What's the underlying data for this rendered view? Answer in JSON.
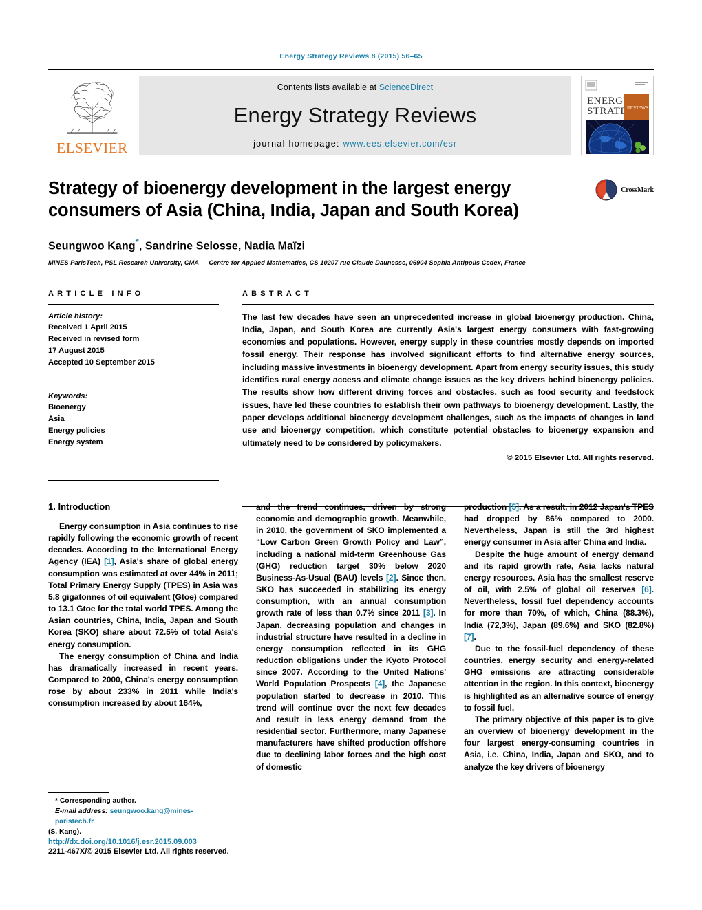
{
  "running_head": "Energy Strategy Reviews 8 (2015) 56–65",
  "masthead": {
    "publisher_name": "ELSEVIER",
    "contents_prefix": "Contents lists available at ",
    "contents_link": "ScienceDirect",
    "journal_name": "Energy Strategy Reviews",
    "homepage_prefix": "journal homepage: ",
    "homepage_url": "www.ees.elsevier.com/esr",
    "cover": {
      "line1": "ENERGY",
      "line2": "STRATEGY",
      "badge": "REVIEWS"
    }
  },
  "article": {
    "title": "Strategy of bioenergy development in the largest energy consumers of Asia (China, India, Japan and South Korea)",
    "authors": "Seungwoo Kang",
    "authors_rest": ", Sandrine Selosse, Nadia Maïzi",
    "corresponding_marker": "*",
    "affiliation": "MINES ParisTech, PSL Research University, CMA — Centre for Applied Mathematics, CS 10207 rue Claude Daunesse, 06904 Sophia Antipolis Cedex, France",
    "crossmark_label": "CrossMark"
  },
  "article_info": {
    "heading": "ARTICLE INFO",
    "history_label": "Article history:",
    "history_lines": [
      "Received 1 April 2015",
      "Received in revised form",
      "17 August 2015",
      "Accepted 10 September 2015"
    ],
    "keywords_label": "Keywords:",
    "keywords": [
      "Bioenergy",
      "Asia",
      "Energy policies",
      "Energy system"
    ]
  },
  "abstract": {
    "heading": "ABSTRACT",
    "text": "The last few decades have seen an unprecedented increase in global bioenergy production. China, India, Japan, and South Korea are currently Asia's largest energy consumers with fast-growing economies and populations. However, energy supply in these countries mostly depends on imported fossil energy. Their response has involved significant efforts to find alternative energy sources, including massive investments in bioenergy development. Apart from energy security issues, this study identifies rural energy access and climate change issues as the key drivers behind bioenergy policies. The results show how different driving forces and obstacles, such as food security and feedstock issues, have led these countries to establish their own pathways to bioenergy development. Lastly, the paper develops additional bioenergy development challenges, such as the impacts of changes in land use and bioenergy competition, which constitute potential obstacles to bioenergy expansion and ultimately need to be considered by policymakers.",
    "copyright": "© 2015 Elsevier Ltd. All rights reserved."
  },
  "body": {
    "section_number_title": "1. Introduction",
    "col1": {
      "p1_a": "Energy consumption in Asia continues to rise rapidly following the economic growth of recent decades. According to the International Energy Agency (IEA) ",
      "p1_ref": "[1]",
      "p1_b": ", Asia's share of global energy consumption was estimated at over 44% in 2011; Total Primary Energy Supply (TPES) in Asia was 5.8 gigatonnes of oil equivalent (Gtoe) compared to 13.1 Gtoe for the total world TPES. Among the Asian countries, China, India, Japan and South Korea (SKO) share about 72.5% of total Asia's energy consumption.",
      "p2": "The energy consumption of China and India has dramatically increased in recent years. Compared to 2000, China's energy consumption rose by about 233% in 2011 while India's consumption increased by about 164%,"
    },
    "col2": {
      "a": "and the trend continues, driven by strong economic and demographic growth. Meanwhile, in 2010, the government of SKO implemented a “Low Carbon Green Growth Policy and Law”, including a national mid-term Greenhouse Gas (GHG) reduction target 30% below 2020 Business-As-Usual (BAU) levels ",
      "ref1": "[2]",
      "b": ". Since then, SKO has succeeded in stabilizing its energy consumption, with an annual consumption growth rate of less than 0.7% since 2011 ",
      "ref2": "[3]",
      "c": ". In Japan, decreasing population and changes in industrial structure have resulted in a decline in energy consumption reflected in its GHG reduction obligations under the Kyoto Protocol since 2007. According to the United Nations' World Population Prospects ",
      "ref3": "[4]",
      "d": ", the Japanese population started to decrease in 2010. This trend will continue over the next few decades and result in less energy demand from the residential sector. Furthermore, many Japanese manufacturers have shifted production offshore due to declining labor forces and the high cost of domestic"
    },
    "col3": {
      "a": "production ",
      "ref1": "[5]",
      "b": ". As a result, in 2012 Japan's TPES had dropped by 86% compared to 2000. Nevertheless, Japan is still the 3rd highest energy consumer in Asia after China and India.",
      "p2_a": "Despite the huge amount of energy demand and its rapid growth rate, Asia lacks natural energy resources. Asia has the smallest reserve of oil, with 2.5% of global oil reserves ",
      "p2_ref1": "[6]",
      "p2_b": ". Nevertheless, fossil fuel dependency accounts for more than 70%, of which, China (88.3%), India (72,3%), Japan (89,6%) and SKO (82.8%) ",
      "p2_ref2": "[7]",
      "p2_c": ".",
      "p3": "Due to the fossil-fuel dependency of these countries, energy security and energy-related GHG emissions are attracting considerable attention in the region. In this context, bioenergy is highlighted as an alternative source of energy to fossil fuel.",
      "p4": "The primary objective of this paper is to give an overview of bioenergy development in the four largest energy-consuming countries in Asia, i.e. China, India, Japan and SKO, and to analyze the key drivers of bioenergy"
    }
  },
  "footnote": {
    "corresponding": "* Corresponding author.",
    "email_label": "E-mail address:",
    "email": "seungwoo.kang@mines-paristech.fr",
    "email_owner": "(S. Kang)."
  },
  "footer": {
    "doi": "http://dx.doi.org/10.1016/j.esr.2015.09.003",
    "issn_copyright": "2211-467X/© 2015 Elsevier Ltd. All rights reserved."
  },
  "colors": {
    "link": "#1a7fa8",
    "elsevier_orange": "#e87722",
    "masthead_bg": "#e6e6e6",
    "crossmark_red": "#c0392b"
  }
}
